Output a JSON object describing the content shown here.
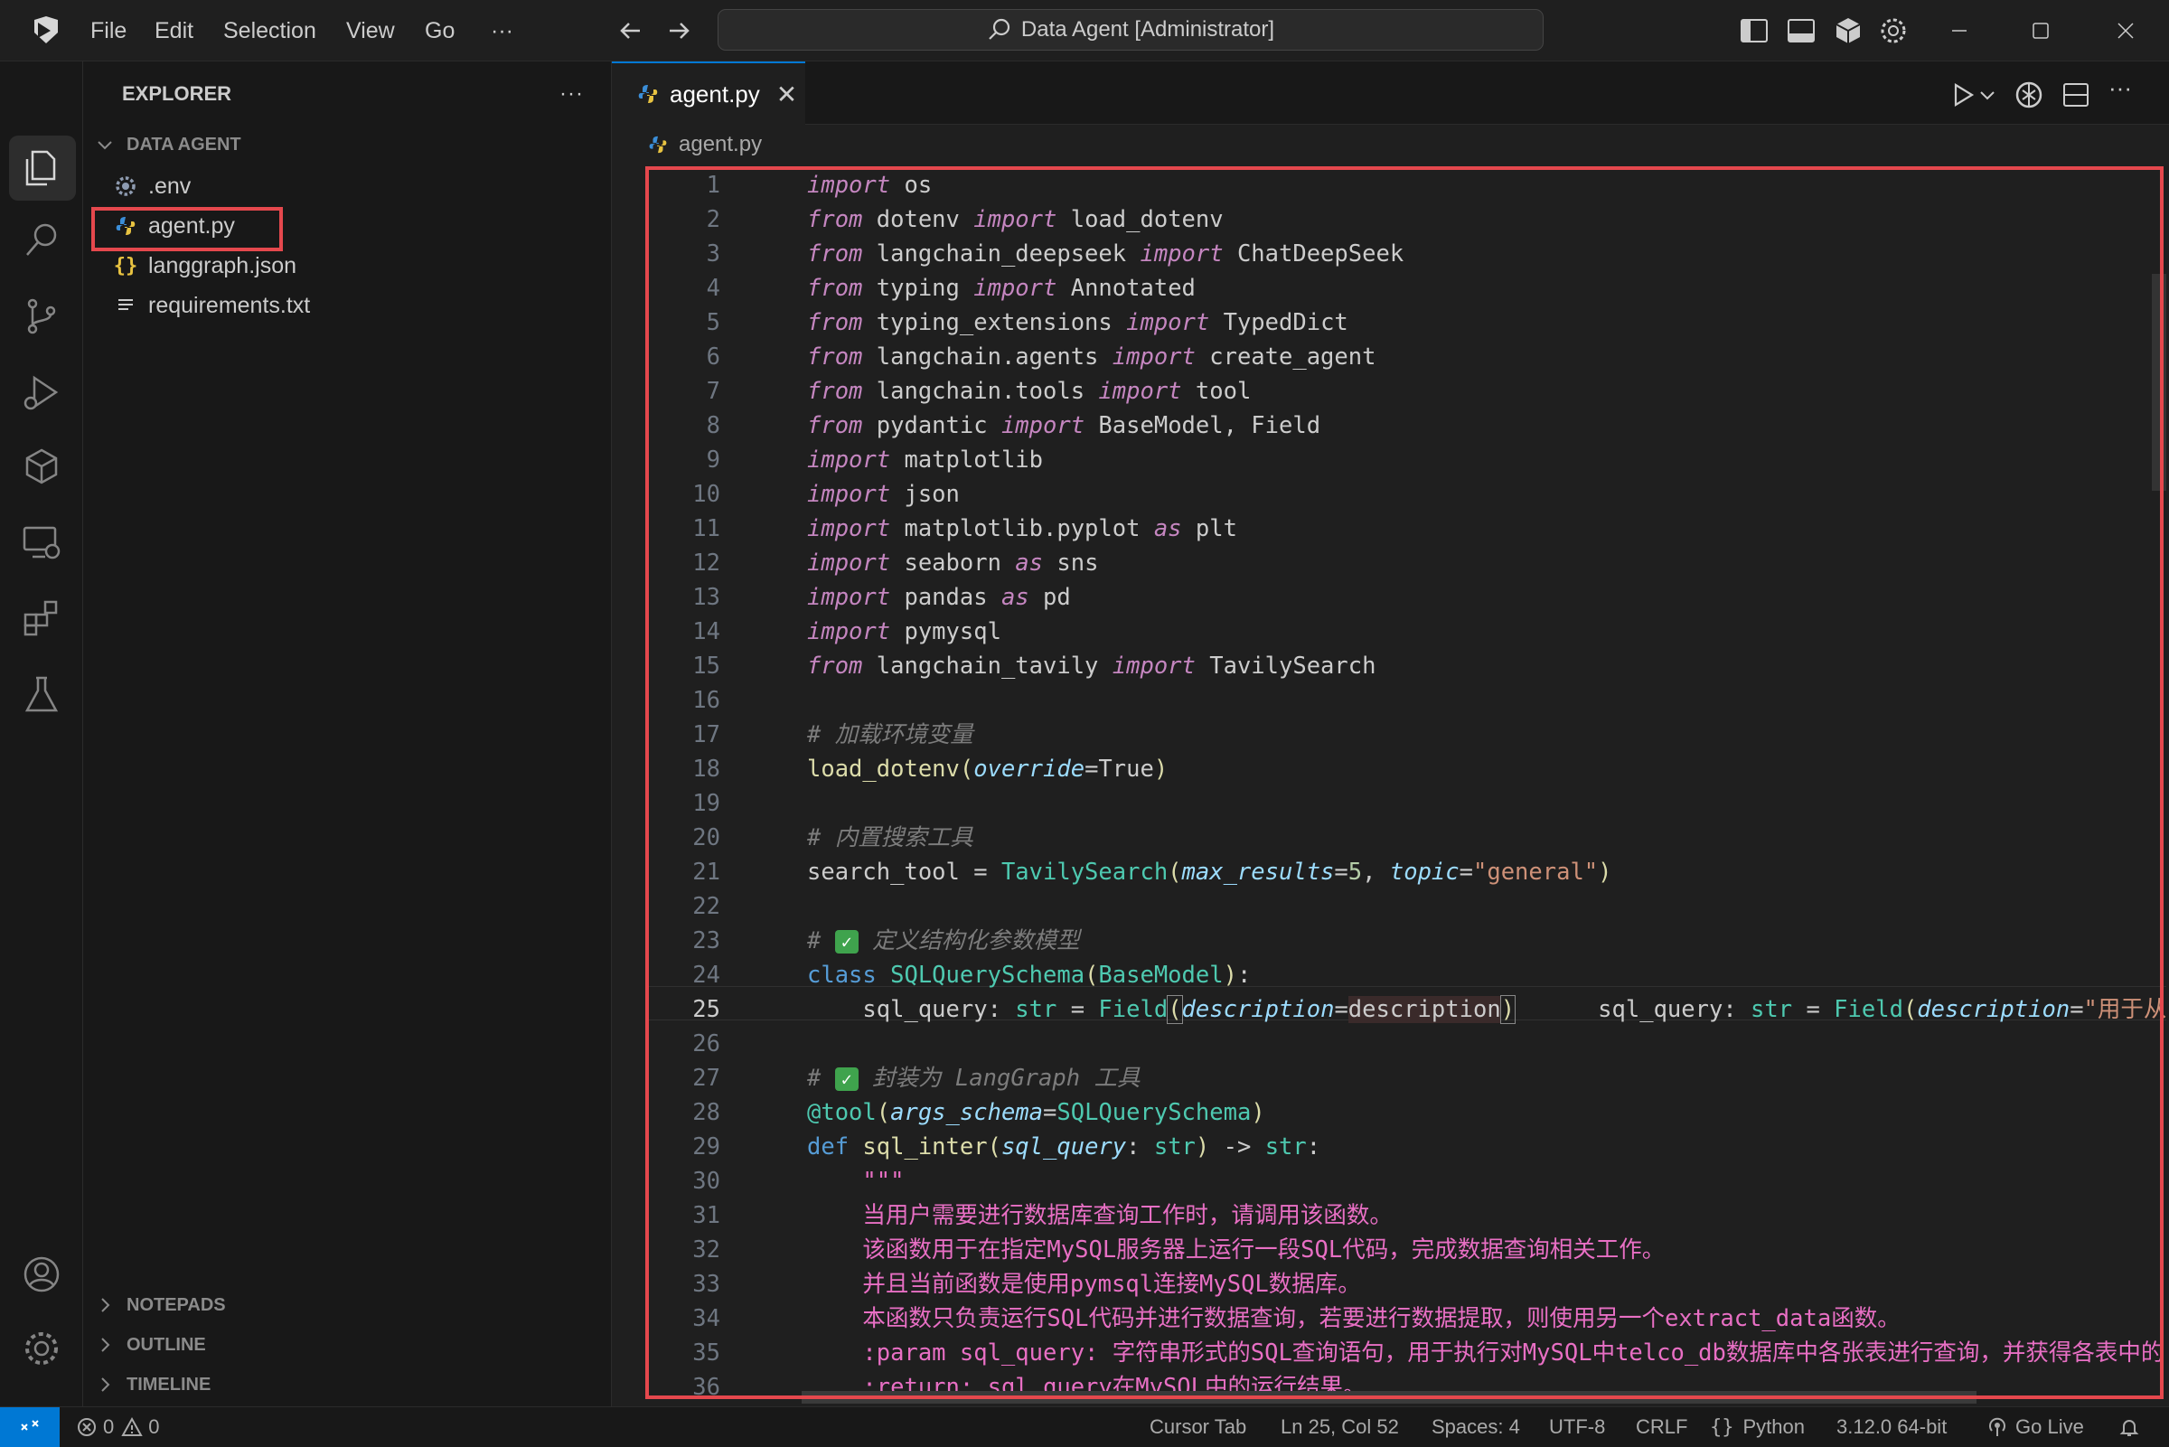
{
  "menu": [
    "File",
    "Edit",
    "Selection",
    "View",
    "Go",
    "···"
  ],
  "command_center": "Data Agent [Administrator]",
  "sidebar": {
    "title": "EXPLORER",
    "more": "···",
    "folder": "DATA AGENT",
    "files": [
      ".env",
      "agent.py",
      "langgraph.json",
      "requirements.txt"
    ],
    "sections": [
      "NOTEPADS",
      "OUTLINE",
      "TIMELINE"
    ]
  },
  "tab": {
    "label": "agent.py",
    "close": "✕"
  },
  "breadcrumb": "agent.py",
  "code_lines": [
    "1",
    "2",
    "3",
    "4",
    "5",
    "6",
    "7",
    "8",
    "9",
    "10",
    "11",
    "12",
    "13",
    "14",
    "15",
    "16",
    "17",
    "18",
    "19",
    "20",
    "21",
    "22",
    "23",
    "24",
    "25",
    "26",
    "27",
    "28",
    "29",
    "30",
    "31",
    "32",
    "33",
    "34",
    "35",
    "36"
  ],
  "status": {
    "errors": "0",
    "warnings": "0",
    "cursor_tab": "Cursor Tab",
    "position": "Ln 25, Col 52",
    "spaces": "Spaces: 4",
    "encoding": "UTF-8",
    "eol": "CRLF",
    "language": "Python",
    "interpreter": "3.12.0 64-bit",
    "go_live": "Go Live"
  },
  "colors": {
    "accent": "#0078d4",
    "highlight": "#e5484d",
    "docstring": "#e86fc4",
    "keyword": "#c586c0"
  }
}
